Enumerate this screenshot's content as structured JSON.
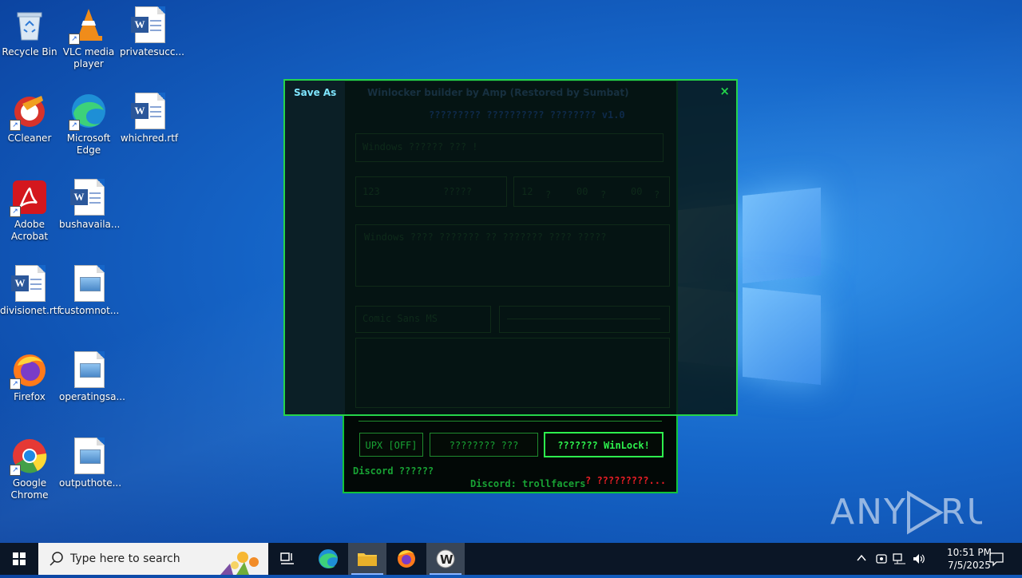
{
  "desktop": {
    "icons": [
      {
        "label": "Recycle Bin"
      },
      {
        "label": "VLC media player"
      },
      {
        "label": "privatesucc..."
      },
      {
        "label": "CCleaner"
      },
      {
        "label": "Microsoft Edge"
      },
      {
        "label": "whichred.rtf"
      },
      {
        "label": "Adobe Acrobat"
      },
      {
        "label": "bushavaila..."
      },
      {
        "label": "divisionet.rtf"
      },
      {
        "label": "customnot..."
      },
      {
        "label": "Firefox"
      },
      {
        "label": "operatingsa..."
      },
      {
        "label": "Google Chrome"
      },
      {
        "label": "outputhote..."
      }
    ]
  },
  "winlocker": {
    "title": "Winlocker builder by Amp (Restored by Sumbat)",
    "header": "????????? ?????????? ???????? v1.0",
    "window_text_value": "Windows ?????? ??? !",
    "code_value": "123",
    "code_label": "?????",
    "timer_values": [
      "12",
      "00",
      "00"
    ],
    "timer_units": [
      "?",
      "?",
      "?"
    ],
    "message_text": "Windows ???? ??????? ?? ??????? ???? ?????",
    "font_value": "Comic Sans MS",
    "upx_label": "UPX [OFF]",
    "test_label": "???????? ???",
    "build_label": "??????? WinLock!",
    "discord_left": "Discord ??????",
    "discord_center": "Discord: trollfacers",
    "about_link": "? ?????????..."
  },
  "save_as": {
    "title": "Save As",
    "close": "×"
  },
  "taskbar": {
    "search_placeholder": "Type here to search",
    "time": "10:51 PM",
    "date": "7/5/2025"
  },
  "watermark": "ANY RUN",
  "colors": {
    "accent_green": "#2df04d",
    "dim_green": "#18a234",
    "alert_red": "#e81d25",
    "dialog_title": "#7fe6ff"
  }
}
